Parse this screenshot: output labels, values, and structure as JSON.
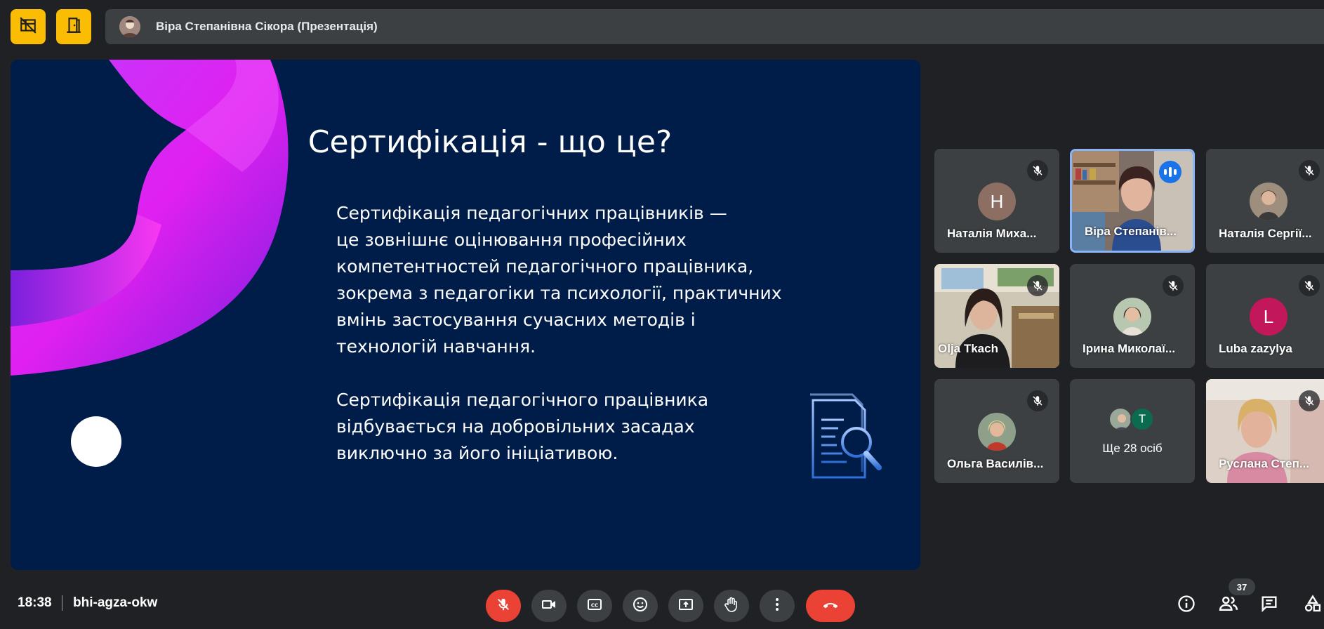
{
  "presenter_bar": {
    "name": "Віра Степанівна Сікора (Презентація)"
  },
  "slide": {
    "title": "Сертифікація - що це?",
    "paragraph1": [
      "Сертифікація педагогічних працівників —",
      "це зовнішнє оцінювання професійних",
      "компетентностей педагогічного працівника,",
      "зокрема з педагогіки та психології, практичних",
      "вмінь застосування сучасних методів і",
      "технологій навчання."
    ],
    "paragraph2": [
      "Сертифікація педагогічного працівника",
      "відбувається на добровільних засадах",
      "виключно за його ініціативою."
    ]
  },
  "participants": [
    {
      "name": "Наталія Миха...",
      "avatar_letter": "H",
      "avatar_color": "#8d6e63",
      "muted": true
    },
    {
      "name": "Віра Степанів...",
      "video": true,
      "speaking": true,
      "active": true
    },
    {
      "name": "Наталія Сергії...",
      "photo": true,
      "muted": true
    },
    {
      "name": "Olja Tkach",
      "video": true,
      "muted": true
    },
    {
      "name": "Ірина Миколаї...",
      "photo": true,
      "muted": true
    },
    {
      "name": "Luba zazylya",
      "avatar_letter": "L",
      "avatar_color": "#c2185b",
      "muted": true
    },
    {
      "name": "Ольга Василів...",
      "photo": true,
      "muted": true
    },
    {
      "name": "Ще 28 осіб",
      "group": true,
      "group_letter": "T"
    },
    {
      "name": "Руслана Степ...",
      "video": true,
      "muted": true
    }
  ],
  "bottom_bar": {
    "time": "18:38",
    "meeting_code": "bhi-agza-okw",
    "people_count": "37"
  },
  "colors": {
    "accent_yellow": "#fbbc04",
    "end_call_red": "#ea4335",
    "slide_bg": "#001d4a",
    "tile_bg": "#3c4043"
  }
}
